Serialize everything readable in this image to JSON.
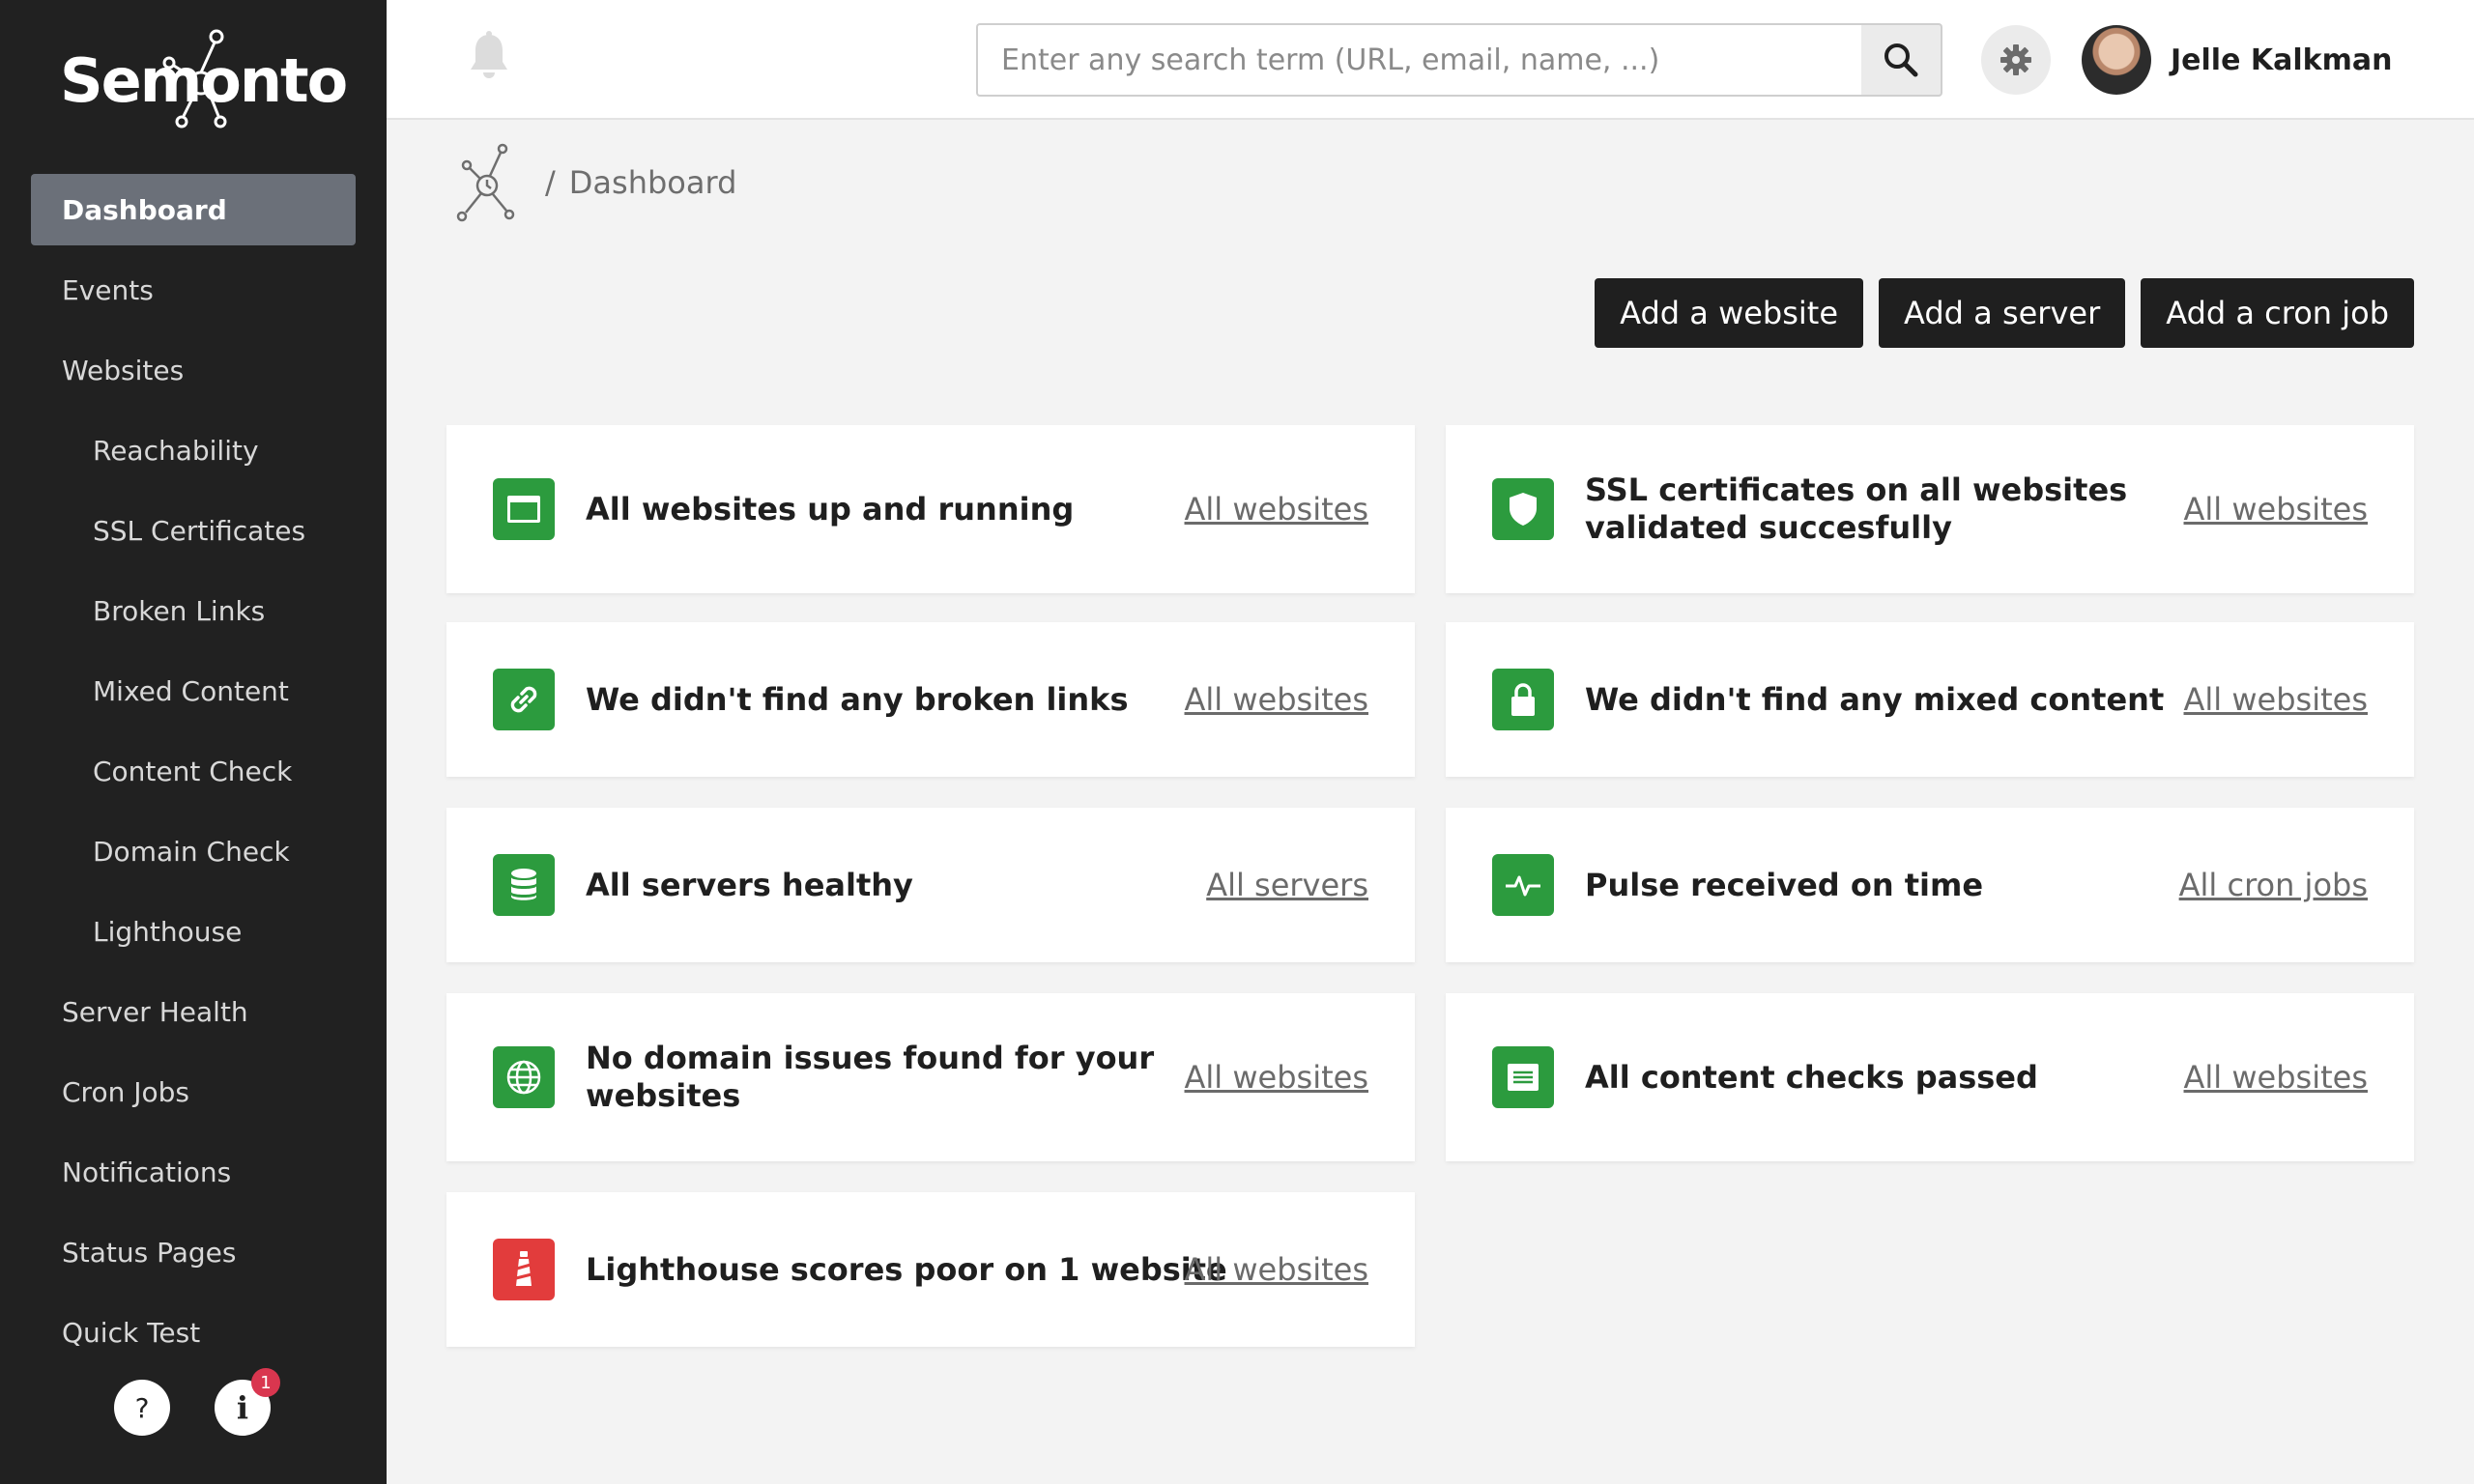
{
  "brand": {
    "name": "Semonto"
  },
  "sidebar": {
    "items": [
      {
        "label": "Dashboard",
        "active": true,
        "sub": false
      },
      {
        "label": "Events",
        "sub": false
      },
      {
        "label": "Websites",
        "sub": false
      },
      {
        "label": "Reachability",
        "sub": true
      },
      {
        "label": "SSL Certificates",
        "sub": true
      },
      {
        "label": "Broken Links",
        "sub": true
      },
      {
        "label": "Mixed Content",
        "sub": true
      },
      {
        "label": "Content Check",
        "sub": true
      },
      {
        "label": "Domain Check",
        "sub": true
      },
      {
        "label": "Lighthouse",
        "sub": true
      },
      {
        "label": "Server Health",
        "sub": false
      },
      {
        "label": "Cron Jobs",
        "sub": false
      },
      {
        "label": "Notifications",
        "sub": false
      },
      {
        "label": "Status Pages",
        "sub": false
      },
      {
        "label": "Quick Test",
        "sub": false
      }
    ],
    "help_label": "?",
    "info_label": "i",
    "info_badge": "1"
  },
  "header": {
    "search_placeholder": "Enter any search term (URL, email, name, ...)",
    "user_name": "Jelle Kalkman"
  },
  "breadcrumb": {
    "separator": "/",
    "current": "Dashboard"
  },
  "actions": {
    "add_website": "Add a website",
    "add_server": "Add a server",
    "add_cron_job": "Add a cron job"
  },
  "cards": [
    {
      "icon": "browser-window-icon",
      "color": "green",
      "title_line1": "All websites up and running",
      "title_line2": "",
      "link": "All websites"
    },
    {
      "icon": "shield-icon",
      "color": "green",
      "title_line1": "SSL certificates on all websites",
      "title_line2": "validated succesfully",
      "link": "All websites"
    },
    {
      "icon": "link-icon",
      "color": "green",
      "title_line1": "We didn't find any broken links",
      "title_line2": "",
      "link": "All websites"
    },
    {
      "icon": "lock-icon",
      "color": "green",
      "title_line1": "We didn't find any mixed content",
      "title_line2": "",
      "link": "All websites"
    },
    {
      "icon": "database-icon",
      "color": "green",
      "title_line1": "All servers healthy",
      "title_line2": "",
      "link": "All servers"
    },
    {
      "icon": "pulse-icon",
      "color": "green",
      "title_line1": "Pulse received on time",
      "title_line2": "",
      "link": "All cron jobs"
    },
    {
      "icon": "globe-icon",
      "color": "green",
      "title_line1": "No domain issues found for your",
      "title_line2": "websites",
      "link": "All websites"
    },
    {
      "icon": "document-icon",
      "color": "green",
      "title_line1": "All content checks passed",
      "title_line2": "",
      "link": "All websites"
    },
    {
      "icon": "lighthouse-icon",
      "color": "red",
      "title_line1": "Lighthouse scores poor on 1 website",
      "title_line2": "",
      "link": "All websites"
    }
  ],
  "colors": {
    "sidebar_bg": "#212121",
    "active_bg": "#6b7079",
    "success": "#2c9b3e",
    "danger": "#e23c3c",
    "badge": "#d9364f"
  }
}
